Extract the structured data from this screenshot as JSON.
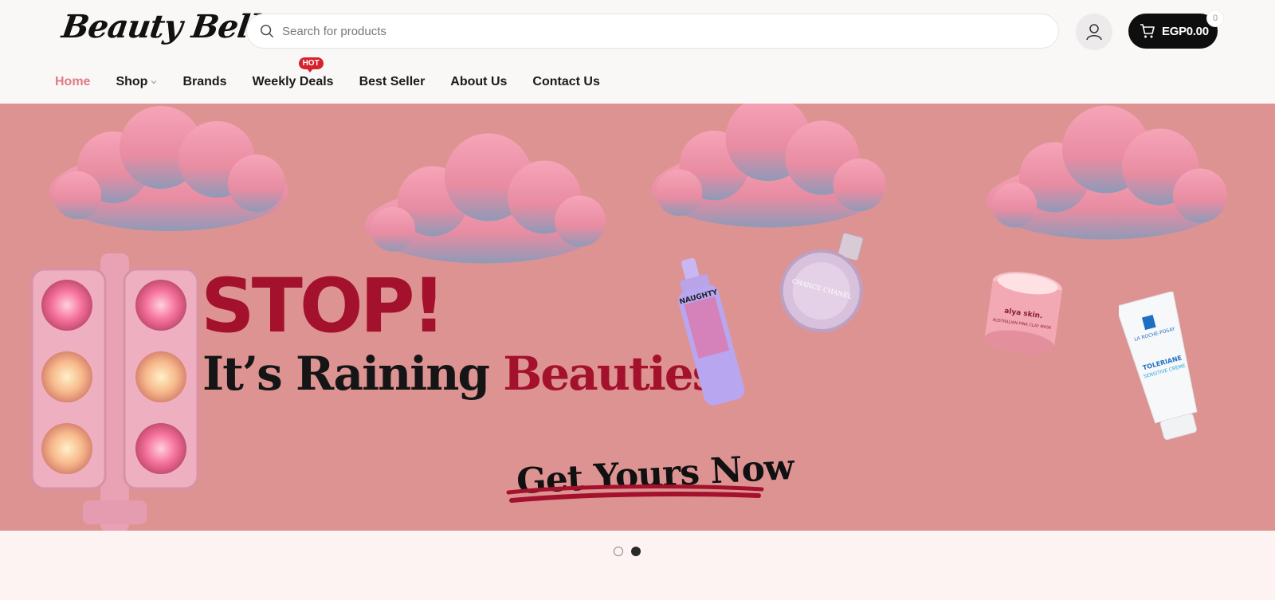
{
  "brand": {
    "logo_text": "Beauty Belle"
  },
  "search": {
    "placeholder": "Search for products",
    "icon": "search-icon"
  },
  "account": {
    "icon": "user-icon"
  },
  "cart": {
    "amount": "EGP0.00",
    "count": "0",
    "icon": "cart-icon"
  },
  "nav": {
    "items": [
      {
        "label": "Home",
        "active": true
      },
      {
        "label": "Shop",
        "has_dropdown": true
      },
      {
        "label": "Brands"
      },
      {
        "label": "Weekly Deals",
        "badge": "HOT"
      },
      {
        "label": "Best Seller"
      },
      {
        "label": "About Us"
      },
      {
        "label": "Contact Us"
      }
    ]
  },
  "hero": {
    "headline": "STOP!",
    "subline_part1": "It’s Raining ",
    "subline_part2": "Beauties",
    "cta": "Get Yours Now",
    "product_labels": {
      "spray": "NAUGHTY",
      "perfume": "CHANCE CHANEL",
      "jar": "alya skin.",
      "jar_sub": "AUSTRALIAN PINK CLAY MASK",
      "tube_brand": "LA ROCHE-POSAY",
      "tube_name": "TOLERIANE",
      "tube_sub": "SENSITIVE CRÈME"
    }
  },
  "slider": {
    "current": 2,
    "total": 2
  },
  "colors": {
    "banner_bg": "#de9393",
    "accent_red": "#a3112c",
    "nav_active": "#e07a86",
    "hot_badge": "#d6222c",
    "cart_bg": "#0e0e0e"
  }
}
